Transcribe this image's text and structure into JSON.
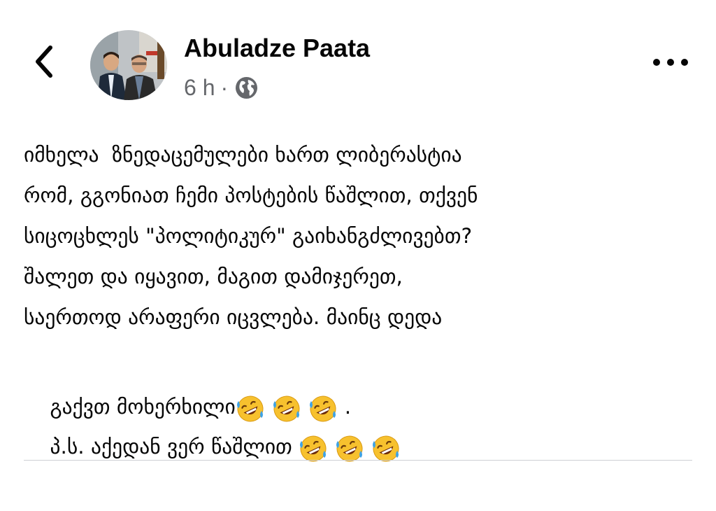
{
  "header": {
    "back_icon": "chevron-left-icon",
    "author_name": "Abuladze Paata",
    "timestamp": "6 h",
    "separator": "·",
    "audience_icon": "globe-icon",
    "more_icon": "more-horizontal-icon"
  },
  "post": {
    "lines": [
      "იმხელა  ზნედაცემულები ხართ ლიბერასტია",
      "რომ, გგონიათ ჩემი პოსტების წაშლით, თქვენ",
      "სიცოცხლეს \"პოლიტიკურ\" გაიხანგძლივებთ?",
      "შალეთ და იყავით, მაგით დამიჯერეთ,",
      "საერთოდ არაფერი იცვლება. მაინც დედა"
    ],
    "line6_text": "გაქვთ მოხერხილი",
    "line6_suffix": ".",
    "line7_text": "პ.ს. აქედან ვერ წაშლით ",
    "emoji": "🤣",
    "emoji_name": "rolling-on-the-floor-laughing"
  },
  "colors": {
    "text": "#050505",
    "secondary_text": "#65676b",
    "divider": "#ced0d4",
    "emoji_face": "#f7c12e",
    "emoji_tears": "#3ea2e6"
  }
}
